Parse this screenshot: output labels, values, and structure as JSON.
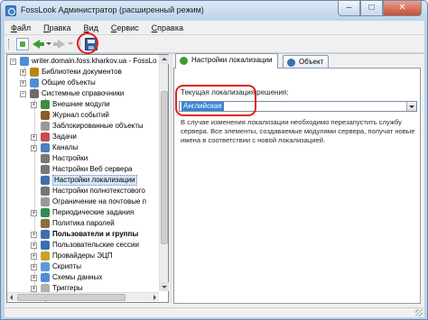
{
  "window": {
    "title": "FossLook Администратор (расширенный режим)"
  },
  "menu": {
    "items": [
      {
        "first": "Ф",
        "rest": "айл"
      },
      {
        "first": "П",
        "rest": "равка"
      },
      {
        "first": "В",
        "rest": "ид"
      },
      {
        "first": "С",
        "rest": "ервис"
      },
      {
        "first": "С",
        "rest": "правка"
      }
    ]
  },
  "tree": {
    "root": "writer.domain.foss.kharkov.ua - FossLo",
    "items": [
      {
        "label": "Библиотеки документов",
        "icon_color": "#b8860b"
      },
      {
        "label": "Общие объекты",
        "icon_color": "#4a90d9"
      },
      {
        "label": "Системные справочники",
        "icon_color": "#6b6b6b"
      },
      {
        "label": "Внешние модули",
        "icon_color": "#3c8d3c"
      },
      {
        "label": "Журнал событий",
        "icon_color": "#8b5a2b"
      },
      {
        "label": "Заблокированные объекты",
        "icon_color": "#999999"
      },
      {
        "label": "Задачи",
        "icon_color": "#c94a4a"
      },
      {
        "label": "Каналы",
        "icon_color": "#4a7fc1"
      },
      {
        "label": "Настройки",
        "icon_color": "#777777"
      },
      {
        "label": "Настройки Веб сервера",
        "icon_color": "#777777"
      },
      {
        "label": "Настройки локализации",
        "icon_color": "#3d6fb0"
      },
      {
        "label": "Настройки полнотекстового",
        "icon_color": "#777777"
      },
      {
        "label": "Ограничение на почтовые п",
        "icon_color": "#999999"
      },
      {
        "label": "Периодические задания",
        "icon_color": "#2e8b57"
      },
      {
        "label": "Политика паролей",
        "icon_color": "#8a6d3b"
      },
      {
        "label": "Пользователи и группы",
        "icon_color": "#3d6fb0"
      },
      {
        "label": "Пользовательские сессии",
        "icon_color": "#3d6fb0"
      },
      {
        "label": "Провайдеры ЭЦП",
        "icon_color": "#c9a227"
      },
      {
        "label": "Скрипты",
        "icon_color": "#5a9bd4"
      },
      {
        "label": "Схемы данных",
        "icon_color": "#4a90d9"
      },
      {
        "label": "Триггеры",
        "icon_color": "#b0b0b0"
      }
    ]
  },
  "tabs": [
    {
      "label": "Настройки локализации",
      "icon_color": "#3a9d2f"
    },
    {
      "label": "Объект",
      "icon_color": "#3d6fb0"
    }
  ],
  "localization": {
    "group_label": "Текущая локализация решения:",
    "selected_value": "Английская",
    "description": "В случае изменения локализации необходимо  перезапустить службу сервера. Все элементы, создаваемые модулями сервера, получат новые имена в соответствии с новой локализацией."
  },
  "toolbar": {
    "refresh": "refresh",
    "back": "back",
    "forward": "forward",
    "save": "save"
  },
  "colors": {
    "highlight_ring": "#e02020",
    "selection": "#3a84d2"
  }
}
